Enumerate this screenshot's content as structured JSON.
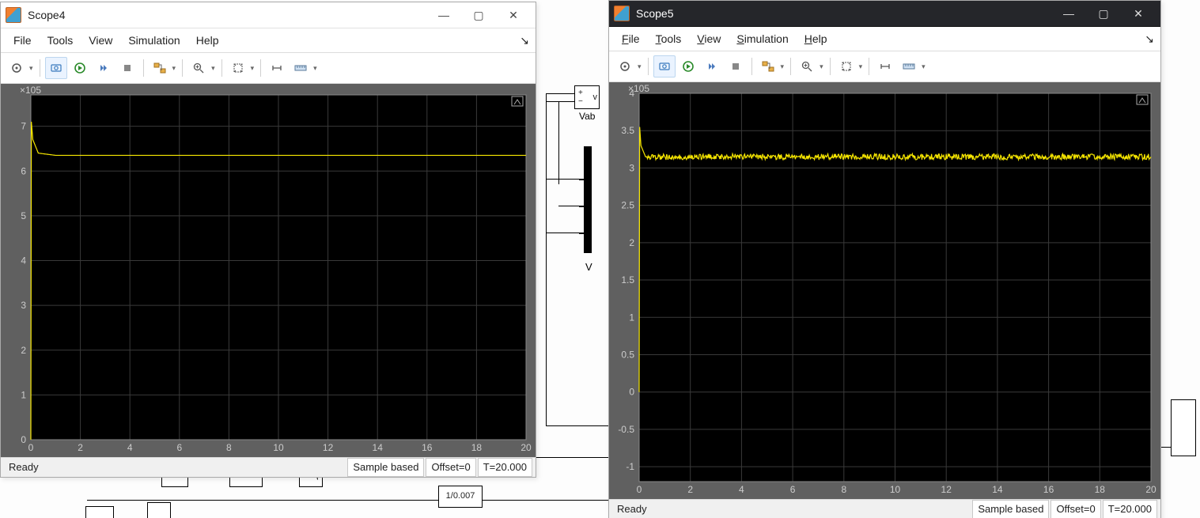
{
  "scope4": {
    "title": "Scope4",
    "menu": {
      "file": "File",
      "tools": "Tools",
      "view": "View",
      "simulation": "Simulation",
      "help": "Help"
    },
    "toolbar_icons": {
      "settings": "settings-gear",
      "camera": "camera-view",
      "run": "run-play",
      "step": "step-forward",
      "stop": "stop-square",
      "signals": "signals",
      "zoom": "zoom-plus",
      "autoscale": "autoscale-arrows",
      "measurements": "measurements-caliper",
      "ruler": "ruler"
    },
    "status": {
      "ready": "Ready",
      "mode": "Sample based",
      "offset": "Offset=0",
      "time": "T=20.000"
    }
  },
  "scope5": {
    "title": "Scope5",
    "menu": {
      "file": "File",
      "tools": "Tools",
      "view": "View",
      "simulation": "Simulation",
      "help": "Help"
    },
    "toolbar_icons": {
      "settings": "settings-gear",
      "camera": "camera-view",
      "run": "run-play",
      "step": "step-forward",
      "stop": "stop-square",
      "signals": "signals",
      "zoom": "zoom-plus",
      "autoscale": "autoscale-arrows",
      "measurements": "measurements-caliper",
      "ruler": "ruler"
    },
    "status": {
      "ready": "Ready",
      "mode": "Sample based",
      "offset": "Offset=0",
      "time": "T=20.000"
    }
  },
  "simulink": {
    "vab_label": "Vab",
    "vbar_label": "V",
    "gain_label": "1/0.007"
  },
  "chart_data": [
    {
      "name": "scope4",
      "type": "line",
      "x_range": [
        0,
        20
      ],
      "x_ticks": [
        0,
        2,
        4,
        6,
        8,
        10,
        12,
        14,
        16,
        18,
        20
      ],
      "y_range": [
        0,
        770000.0
      ],
      "y_exponent": "×10^5",
      "y_ticks": [
        0,
        1,
        2,
        3,
        4,
        5,
        6,
        7
      ],
      "data": [
        {
          "x": 0.0,
          "y": 0
        },
        {
          "x": 0.02,
          "y": 710000.0
        },
        {
          "x": 0.08,
          "y": 670000.0
        },
        {
          "x": 0.3,
          "y": 640000.0
        },
        {
          "x": 1.0,
          "y": 635000.0
        },
        {
          "x": 5.0,
          "y": 635000.0
        },
        {
          "x": 10.0,
          "y": 635000.0
        },
        {
          "x": 15.0,
          "y": 635000.0
        },
        {
          "x": 20.0,
          "y": 635000.0
        }
      ],
      "line_color": "#f6e600"
    },
    {
      "name": "scope5",
      "type": "line",
      "x_range": [
        0,
        20
      ],
      "x_ticks": [
        0,
        2,
        4,
        6,
        8,
        10,
        12,
        14,
        16,
        18,
        20
      ],
      "y_range": [
        -120000.0,
        400000.0
      ],
      "y_exponent": "×10^5",
      "y_ticks": [
        -1,
        -0.5,
        0,
        0.5,
        1,
        1.5,
        2,
        2.5,
        3,
        3.5,
        4
      ],
      "data": [
        {
          "x": 0.0,
          "y": 0
        },
        {
          "x": 0.02,
          "y": 355000.0
        },
        {
          "x": 0.07,
          "y": 330000.0
        },
        {
          "x": 0.25,
          "y": 315000.0
        },
        {
          "x": 1.0,
          "y": 315000.0
        },
        {
          "x": 5.0,
          "y": 315000.0
        },
        {
          "x": 10.0,
          "y": 315000.0
        },
        {
          "x": 15.0,
          "y": 315000.0
        },
        {
          "x": 20.0,
          "y": 315000.0
        }
      ],
      "noise_amp": 4000.0,
      "line_color": "#f6e600"
    }
  ]
}
